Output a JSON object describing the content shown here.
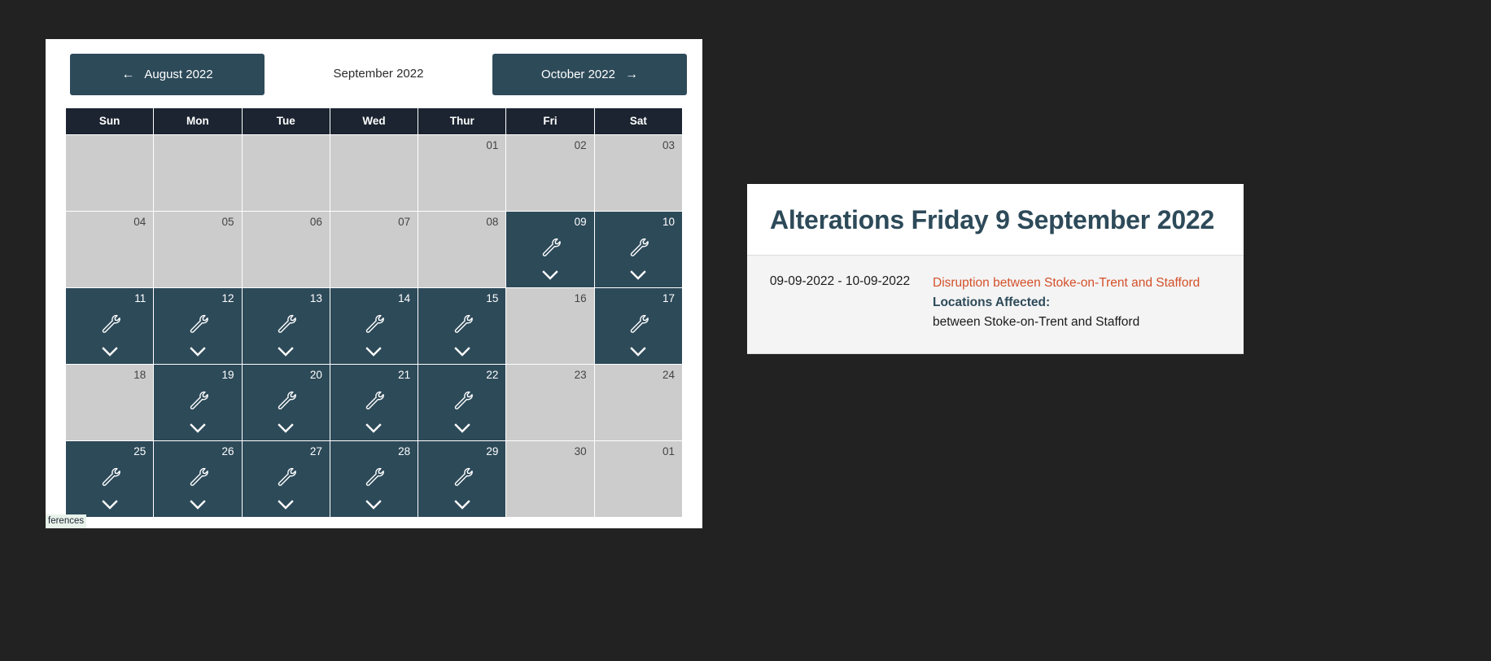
{
  "calendar": {
    "prev_month_label": "August 2022",
    "current_month_label": "September 2022",
    "next_month_label": "October 2022",
    "prev_arrow": "←",
    "next_arrow": "→",
    "weekdays": [
      "Sun",
      "Mon",
      "Tue",
      "Wed",
      "Thur",
      "Fri",
      "Sat"
    ],
    "weeks": [
      [
        {
          "label": "",
          "active": false,
          "has_event": false
        },
        {
          "label": "",
          "active": false,
          "has_event": false
        },
        {
          "label": "",
          "active": false,
          "has_event": false
        },
        {
          "label": "",
          "active": false,
          "has_event": false
        },
        {
          "label": "01",
          "active": false,
          "has_event": false
        },
        {
          "label": "02",
          "active": false,
          "has_event": false
        },
        {
          "label": "03",
          "active": false,
          "has_event": false
        }
      ],
      [
        {
          "label": "04",
          "active": false,
          "has_event": false
        },
        {
          "label": "05",
          "active": false,
          "has_event": false
        },
        {
          "label": "06",
          "active": false,
          "has_event": false
        },
        {
          "label": "07",
          "active": false,
          "has_event": false
        },
        {
          "label": "08",
          "active": false,
          "has_event": false
        },
        {
          "label": "09",
          "active": true,
          "has_event": true
        },
        {
          "label": "10",
          "active": true,
          "has_event": true
        }
      ],
      [
        {
          "label": "11",
          "active": true,
          "has_event": true
        },
        {
          "label": "12",
          "active": true,
          "has_event": true
        },
        {
          "label": "13",
          "active": true,
          "has_event": true
        },
        {
          "label": "14",
          "active": true,
          "has_event": true
        },
        {
          "label": "15",
          "active": true,
          "has_event": true
        },
        {
          "label": "16",
          "active": false,
          "has_event": false
        },
        {
          "label": "17",
          "active": true,
          "has_event": true
        }
      ],
      [
        {
          "label": "18",
          "active": false,
          "has_event": false
        },
        {
          "label": "19",
          "active": true,
          "has_event": true
        },
        {
          "label": "20",
          "active": true,
          "has_event": true
        },
        {
          "label": "21",
          "active": true,
          "has_event": true
        },
        {
          "label": "22",
          "active": true,
          "has_event": true
        },
        {
          "label": "23",
          "active": false,
          "has_event": false
        },
        {
          "label": "24",
          "active": false,
          "has_event": false
        }
      ],
      [
        {
          "label": "25",
          "active": true,
          "has_event": true
        },
        {
          "label": "26",
          "active": true,
          "has_event": true
        },
        {
          "label": "27",
          "active": true,
          "has_event": true
        },
        {
          "label": "28",
          "active": true,
          "has_event": true
        },
        {
          "label": "29",
          "active": true,
          "has_event": true
        },
        {
          "label": "30",
          "active": false,
          "has_event": false
        },
        {
          "label": "01",
          "active": false,
          "has_event": false
        }
      ]
    ]
  },
  "bottom_status": {
    "text": "ferences"
  },
  "detail": {
    "title": "Alterations Friday 9 September 2022",
    "date_range": "09-09-2022 - 10-09-2022",
    "disruption_headline": "Disruption between Stoke-on-Trent and Stafford",
    "locations_label": "Locations Affected:",
    "locations_value": "between Stoke-on-Trent and Stafford"
  },
  "colors": {
    "active_day": "#2d4a59",
    "inactive_day": "#cccccc",
    "weekday_header": "#1b2430",
    "accent_red": "#d4502a",
    "panel_heading": "#2d4a59",
    "page_background": "#222222"
  }
}
